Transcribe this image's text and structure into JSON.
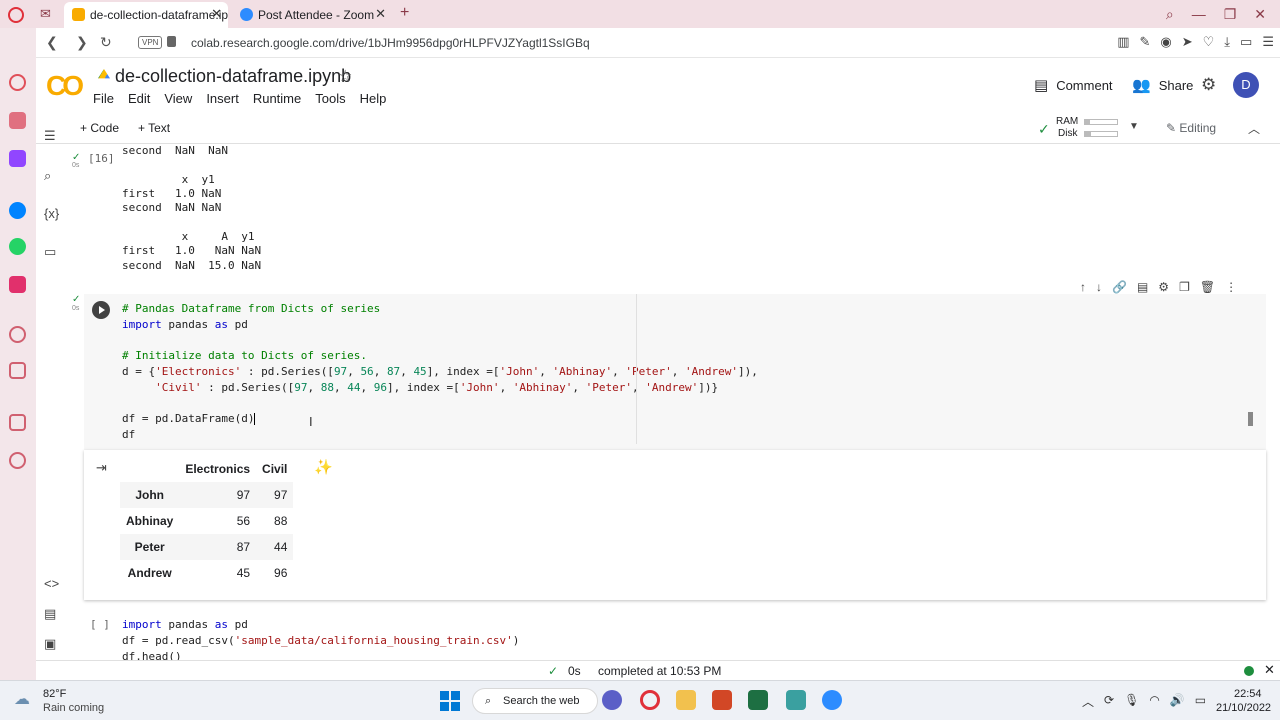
{
  "browser": {
    "tabs": [
      {
        "title": "de-collection-dataframe.ip"
      },
      {
        "title": "Post Attendee - Zoom"
      }
    ],
    "url": "colab.research.google.com/drive/1bJHm9956dpg0rHLPFVJZYagtl1SsIGBq",
    "vpn": "VPN"
  },
  "colab": {
    "logo": "CO",
    "title": "de-collection-dataframe.ipynb",
    "menu": [
      "File",
      "Edit",
      "View",
      "Insert",
      "Runtime",
      "Tools",
      "Help"
    ],
    "comment": "Comment",
    "share": "Share",
    "avatar": "D",
    "add_code": "+ Code",
    "add_text": "+ Text",
    "ram": "RAM",
    "disk": "Disk",
    "ram_level": 0.15,
    "disk_level": 0.2,
    "editing": "Editing"
  },
  "cell1": {
    "exec_count": "[16]",
    "time": "0s",
    "output_lines": [
      "second  NaN  NaN",
      "",
      "         x  y1",
      "first   1.0 NaN",
      "second  NaN NaN",
      "",
      "",
      "         x     A  y1",
      "first   1.0   NaN NaN",
      "second  NaN  15.0 NaN"
    ]
  },
  "cell2": {
    "time": "0s",
    "comment1": "# Pandas Dataframe from Dicts of series",
    "import_kw": "import",
    "import_rest": " pandas ",
    "as_kw": "as",
    "pd": " pd",
    "comment2": "# Initialize data to Dicts of series.",
    "line4a": "d = {",
    "s_elec": "'Electronics'",
    "line4b": " : pd.Series([",
    "n1": "97",
    "n2": "56",
    "n3": "87",
    "n4": "45",
    "line4c": "], index =[",
    "s_john": "'John'",
    "s_abh": "'Abhinay'",
    "s_pet": "'Peter'",
    "s_and": "'Andrew'",
    "line4d": "]),",
    "s_civil": "'Civil'",
    "m1": "97",
    "m2": "88",
    "m3": "44",
    "m4": "96",
    "line5d": "])}",
    "line6": "df = pd.DataFrame(d)",
    "line7": "df",
    "df_table": {
      "columns": [
        "Electronics",
        "Civil"
      ],
      "rows": [
        {
          "index": "John",
          "Electronics": "97",
          "Civil": "97"
        },
        {
          "index": "Abhinay",
          "Electronics": "56",
          "Civil": "88"
        },
        {
          "index": "Peter",
          "Electronics": "87",
          "Civil": "44"
        },
        {
          "index": "Andrew",
          "Electronics": "45",
          "Civil": "96"
        }
      ]
    }
  },
  "cell3": {
    "exec_count": "[ ]",
    "import_kw": "import",
    "import_rest": " pandas ",
    "as_kw": "as",
    "pd": " pd",
    "line2a": "df = pd.read_csv(",
    "s_path": "'sample_data/california_housing_train.csv'",
    "line2b": ")",
    "line3": "df.head()"
  },
  "status": {
    "time": "0s",
    "message": "completed at 10:53 PM"
  },
  "taskbar": {
    "temp": "82°F",
    "weather": "Rain coming",
    "search": "Search the web",
    "time": "22:54",
    "date": "21/10/2022"
  },
  "colors": {
    "accent_orange": "#f9ab00",
    "success_green": "#1e8e3e",
    "avatar_blue": "#3f51b5"
  }
}
